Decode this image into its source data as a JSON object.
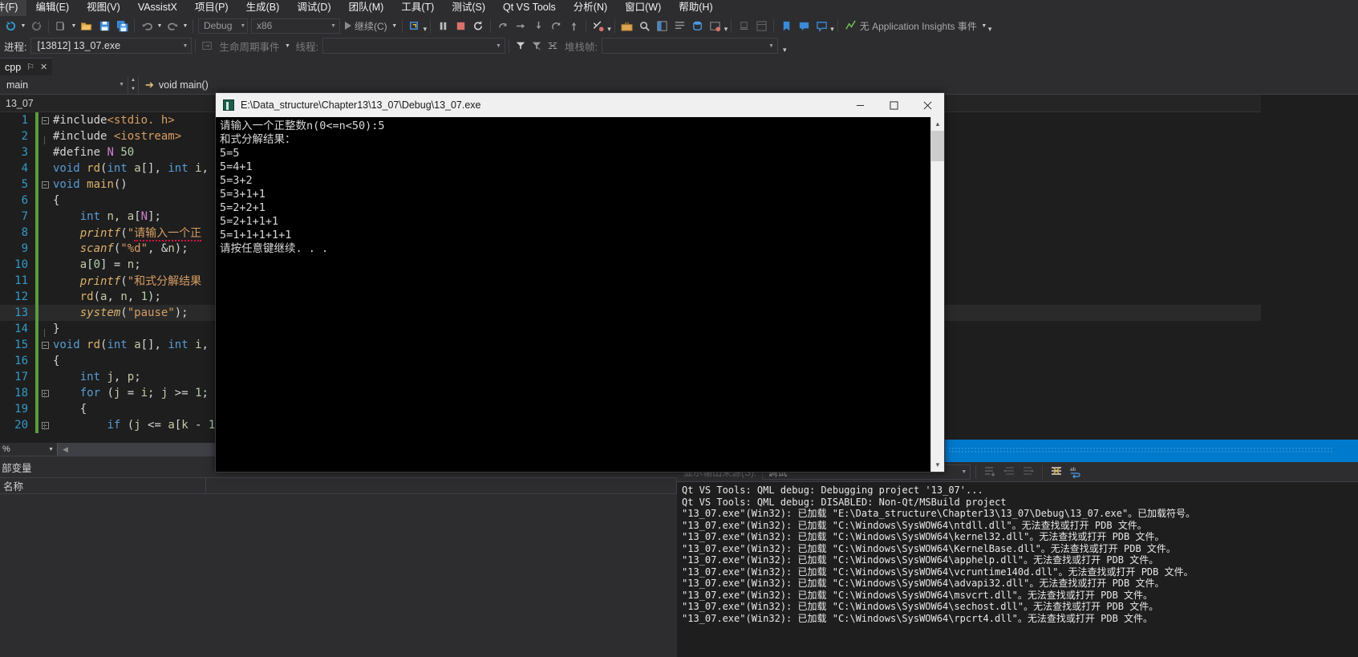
{
  "menu": {
    "items": [
      {
        "label": "件(F)"
      },
      {
        "label": "编辑(E)"
      },
      {
        "label": "视图(V)"
      },
      {
        "label": "VAssistX"
      },
      {
        "label": "项目(P)"
      },
      {
        "label": "生成(B)"
      },
      {
        "label": "调试(D)"
      },
      {
        "label": "团队(M)"
      },
      {
        "label": "工具(T)"
      },
      {
        "label": "测试(S)"
      },
      {
        "label": "Qt VS Tools"
      },
      {
        "label": "分析(N)"
      },
      {
        "label": "窗口(W)"
      },
      {
        "label": "帮助(H)"
      }
    ]
  },
  "toolbar": {
    "config_value": "Debug",
    "platform_value": "x86",
    "continue_label": "继续(C)",
    "app_insights_label": "无 Application Insights 事件"
  },
  "process_bar": {
    "process_label": "进程:",
    "process_value": "[13812] 13_07.exe",
    "lifecycle_label": "生命周期事件",
    "thread_label": "线程:",
    "thread_value": "",
    "stackframe_label": "堆栈帧:",
    "stackframe_value": ""
  },
  "doc_tab": {
    "title": "cpp",
    "pin_icon": "pin-icon",
    "close_icon": "close-icon"
  },
  "navbar": {
    "scope_value": "main",
    "member_value": "void main()"
  },
  "editor": {
    "path_label": "13_07",
    "zoom_value": "%",
    "lines": [
      {
        "n": "1",
        "fold": "minus",
        "indent": 0,
        "text": "#include<stdio. h>"
      },
      {
        "n": "2",
        "fold": "line",
        "indent": 0,
        "text": "#include <iostream>"
      },
      {
        "n": "3",
        "fold": "none",
        "indent": 0,
        "text": "#define N 50"
      },
      {
        "n": "4",
        "fold": "none",
        "indent": 0,
        "text": "void rd(int a[], int i,"
      },
      {
        "n": "5",
        "fold": "minus",
        "indent": 0,
        "text": "void main()"
      },
      {
        "n": "6",
        "fold": "line",
        "indent": 0,
        "text": "{"
      },
      {
        "n": "7",
        "fold": "line",
        "indent": 1,
        "text": "int n, a[N];"
      },
      {
        "n": "8",
        "fold": "line",
        "indent": 1,
        "text": "printf(\"请输入一个正"
      },
      {
        "n": "9",
        "fold": "line",
        "indent": 1,
        "text": "scanf(\"%d\", &n);"
      },
      {
        "n": "10",
        "fold": "line",
        "indent": 1,
        "text": "a[0] = n;"
      },
      {
        "n": "11",
        "fold": "line",
        "indent": 1,
        "text": "printf(\"和式分解结果"
      },
      {
        "n": "12",
        "fold": "line",
        "indent": 1,
        "text": "rd(a, n, 1);"
      },
      {
        "n": "13",
        "fold": "line",
        "indent": 1,
        "text": "system(\"pause\");",
        "current": true
      },
      {
        "n": "14",
        "fold": "line",
        "indent": 0,
        "text": "}"
      },
      {
        "n": "15",
        "fold": "minus",
        "indent": 0,
        "text": "void rd(int a[], int i,"
      },
      {
        "n": "16",
        "fold": "line",
        "indent": 0,
        "text": "{"
      },
      {
        "n": "17",
        "fold": "line",
        "indent": 1,
        "text": "int j, p;"
      },
      {
        "n": "18",
        "fold": "minus",
        "indent": 1,
        "text": "for (j = i; j >= 1;"
      },
      {
        "n": "19",
        "fold": "line",
        "indent": 1,
        "text": "{"
      },
      {
        "n": "20",
        "fold": "minus",
        "indent": 2,
        "text": "if (j <= a[k - 1"
      }
    ]
  },
  "locals": {
    "title": "部变量",
    "column_name": "名称"
  },
  "console": {
    "title": "E:\\Data_structure\\Chapter13\\13_07\\Debug\\13_07.exe",
    "minimize_label": "—",
    "maximize_label": "□",
    "close_label": "✕",
    "output": "请输入一个正整数n(0<=n<50):5\n和式分解结果：\n5=5\n5=4+1\n5=3+2\n5=3+1+1\n5=2+2+1\n5=2+1+1+1\n5=1+1+1+1+1\n请按任意键继续. . ."
  },
  "output_panel": {
    "source_label": "显示输出来源(S):",
    "source_value": "调试",
    "lines": [
      "Qt VS Tools: QML debug: Debugging project '13_07'...",
      "Qt VS Tools: QML debug: DISABLED: Non-Qt/MSBuild project",
      "\"13_07.exe\"(Win32): 已加载 \"E:\\Data_structure\\Chapter13\\13_07\\Debug\\13_07.exe\"。已加载符号。",
      "\"13_07.exe\"(Win32): 已加载 \"C:\\Windows\\SysWOW64\\ntdll.dll\"。无法查找或打开 PDB 文件。",
      "\"13_07.exe\"(Win32): 已加载 \"C:\\Windows\\SysWOW64\\kernel32.dll\"。无法查找或打开 PDB 文件。",
      "\"13_07.exe\"(Win32): 已加载 \"C:\\Windows\\SysWOW64\\KernelBase.dll\"。无法查找或打开 PDB 文件。",
      "\"13_07.exe\"(Win32): 已加载 \"C:\\Windows\\SysWOW64\\apphelp.dll\"。无法查找或打开 PDB 文件。",
      "\"13_07.exe\"(Win32): 已加载 \"C:\\Windows\\SysWOW64\\vcruntime140d.dll\"。无法查找或打开 PDB 文件。",
      "\"13_07.exe\"(Win32): 已加载 \"C:\\Windows\\SysWOW64\\advapi32.dll\"。无法查找或打开 PDB 文件。",
      "\"13_07.exe\"(Win32): 已加载 \"C:\\Windows\\SysWOW64\\msvcrt.dll\"。无法查找或打开 PDB 文件。",
      "\"13_07.exe\"(Win32): 已加载 \"C:\\Windows\\SysWOW64\\sechost.dll\"。无法查找或打开 PDB 文件。",
      "\"13_07.exe\"(Win32): 已加载 \"C:\\Windows\\SysWOW64\\rpcrt4.dll\"。无法查找或打开 PDB 文件。"
    ]
  },
  "colors": {
    "accent": "#007acc",
    "chrome": "#2d2d30",
    "editor_bg": "#1e1e1e",
    "console_bg": "#000000",
    "changed_marker": "#5b9b3e"
  }
}
